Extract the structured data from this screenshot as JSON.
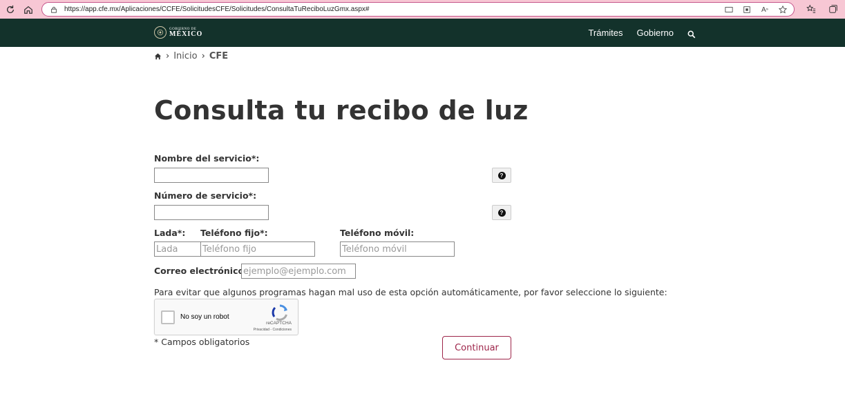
{
  "browser": {
    "url": "https://app.cfe.mx/Aplicaciones/CCFE/SolicitudesCFE/Solicitudes/ConsultaTuReciboLuzGmx.aspx#"
  },
  "header": {
    "logo_line1": "GOBIERNO DE",
    "logo_line2": "MÉXICO",
    "nav": [
      "Trámites",
      "Gobierno"
    ]
  },
  "breadcrumb": {
    "items": [
      "Inicio",
      "CFE"
    ]
  },
  "page": {
    "title": "Consulta tu recibo de luz"
  },
  "form": {
    "service_name_label": "Nombre del servicio*:",
    "service_number_label": "Número de servicio*:",
    "lada_label": "Lada*:",
    "lada_placeholder": "Lada",
    "phone_label": "Teléfono fijo*:",
    "phone_placeholder": "Teléfono fijo",
    "mobile_label": "Teléfono móvil:",
    "mobile_placeholder": "Teléfono móvil",
    "email_label": "Correo electrónico*:",
    "email_placeholder": "ejemplo@ejemplo.com",
    "notice": "Para evitar que algunos programas hagan mal uso de esta opción automáticamente, por favor seleccione lo siguiente:",
    "required_note": "* Campos obligatorios",
    "submit_label": "Continuar"
  },
  "captcha": {
    "label": "No soy un robot",
    "brand": "reCAPTCHA",
    "terms": "Privacidad - Condiciones"
  },
  "colors": {
    "header_bg": "#13322b",
    "accent": "#9d2449",
    "browser_bar": "#f7c7d4"
  }
}
